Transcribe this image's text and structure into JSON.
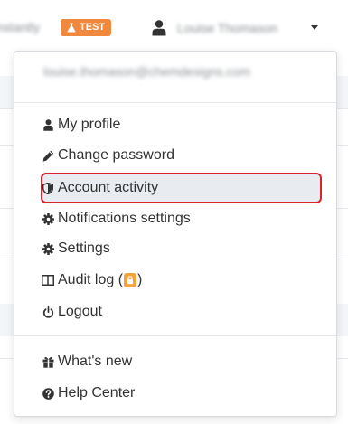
{
  "topbar": {
    "left_text": "Instantly",
    "badge": {
      "label": "TEST",
      "color": "#f0883e"
    },
    "user_name": "Louise Thomason"
  },
  "menu": {
    "email": "louise.thomason@chemdesigns.com",
    "items": [
      {
        "label": "My profile",
        "icon": "user-icon"
      },
      {
        "label": "Change password",
        "icon": "pencil-icon"
      },
      {
        "label": "Account activity",
        "icon": "shield-icon",
        "highlighted": true
      },
      {
        "label": "Notifications settings",
        "icon": "gear-icon"
      },
      {
        "label": "Settings",
        "icon": "gear-icon"
      },
      {
        "label": "Audit log (",
        "suffix": ")",
        "icon": "columns-icon",
        "badge_icon": "lock-icon"
      },
      {
        "label": "Logout",
        "icon": "power-icon"
      }
    ],
    "secondary_items": [
      {
        "label": "What's new",
        "icon": "gift-icon"
      },
      {
        "label": "Help Center",
        "icon": "question-icon"
      }
    ],
    "highlight_color": "#d9232c"
  }
}
